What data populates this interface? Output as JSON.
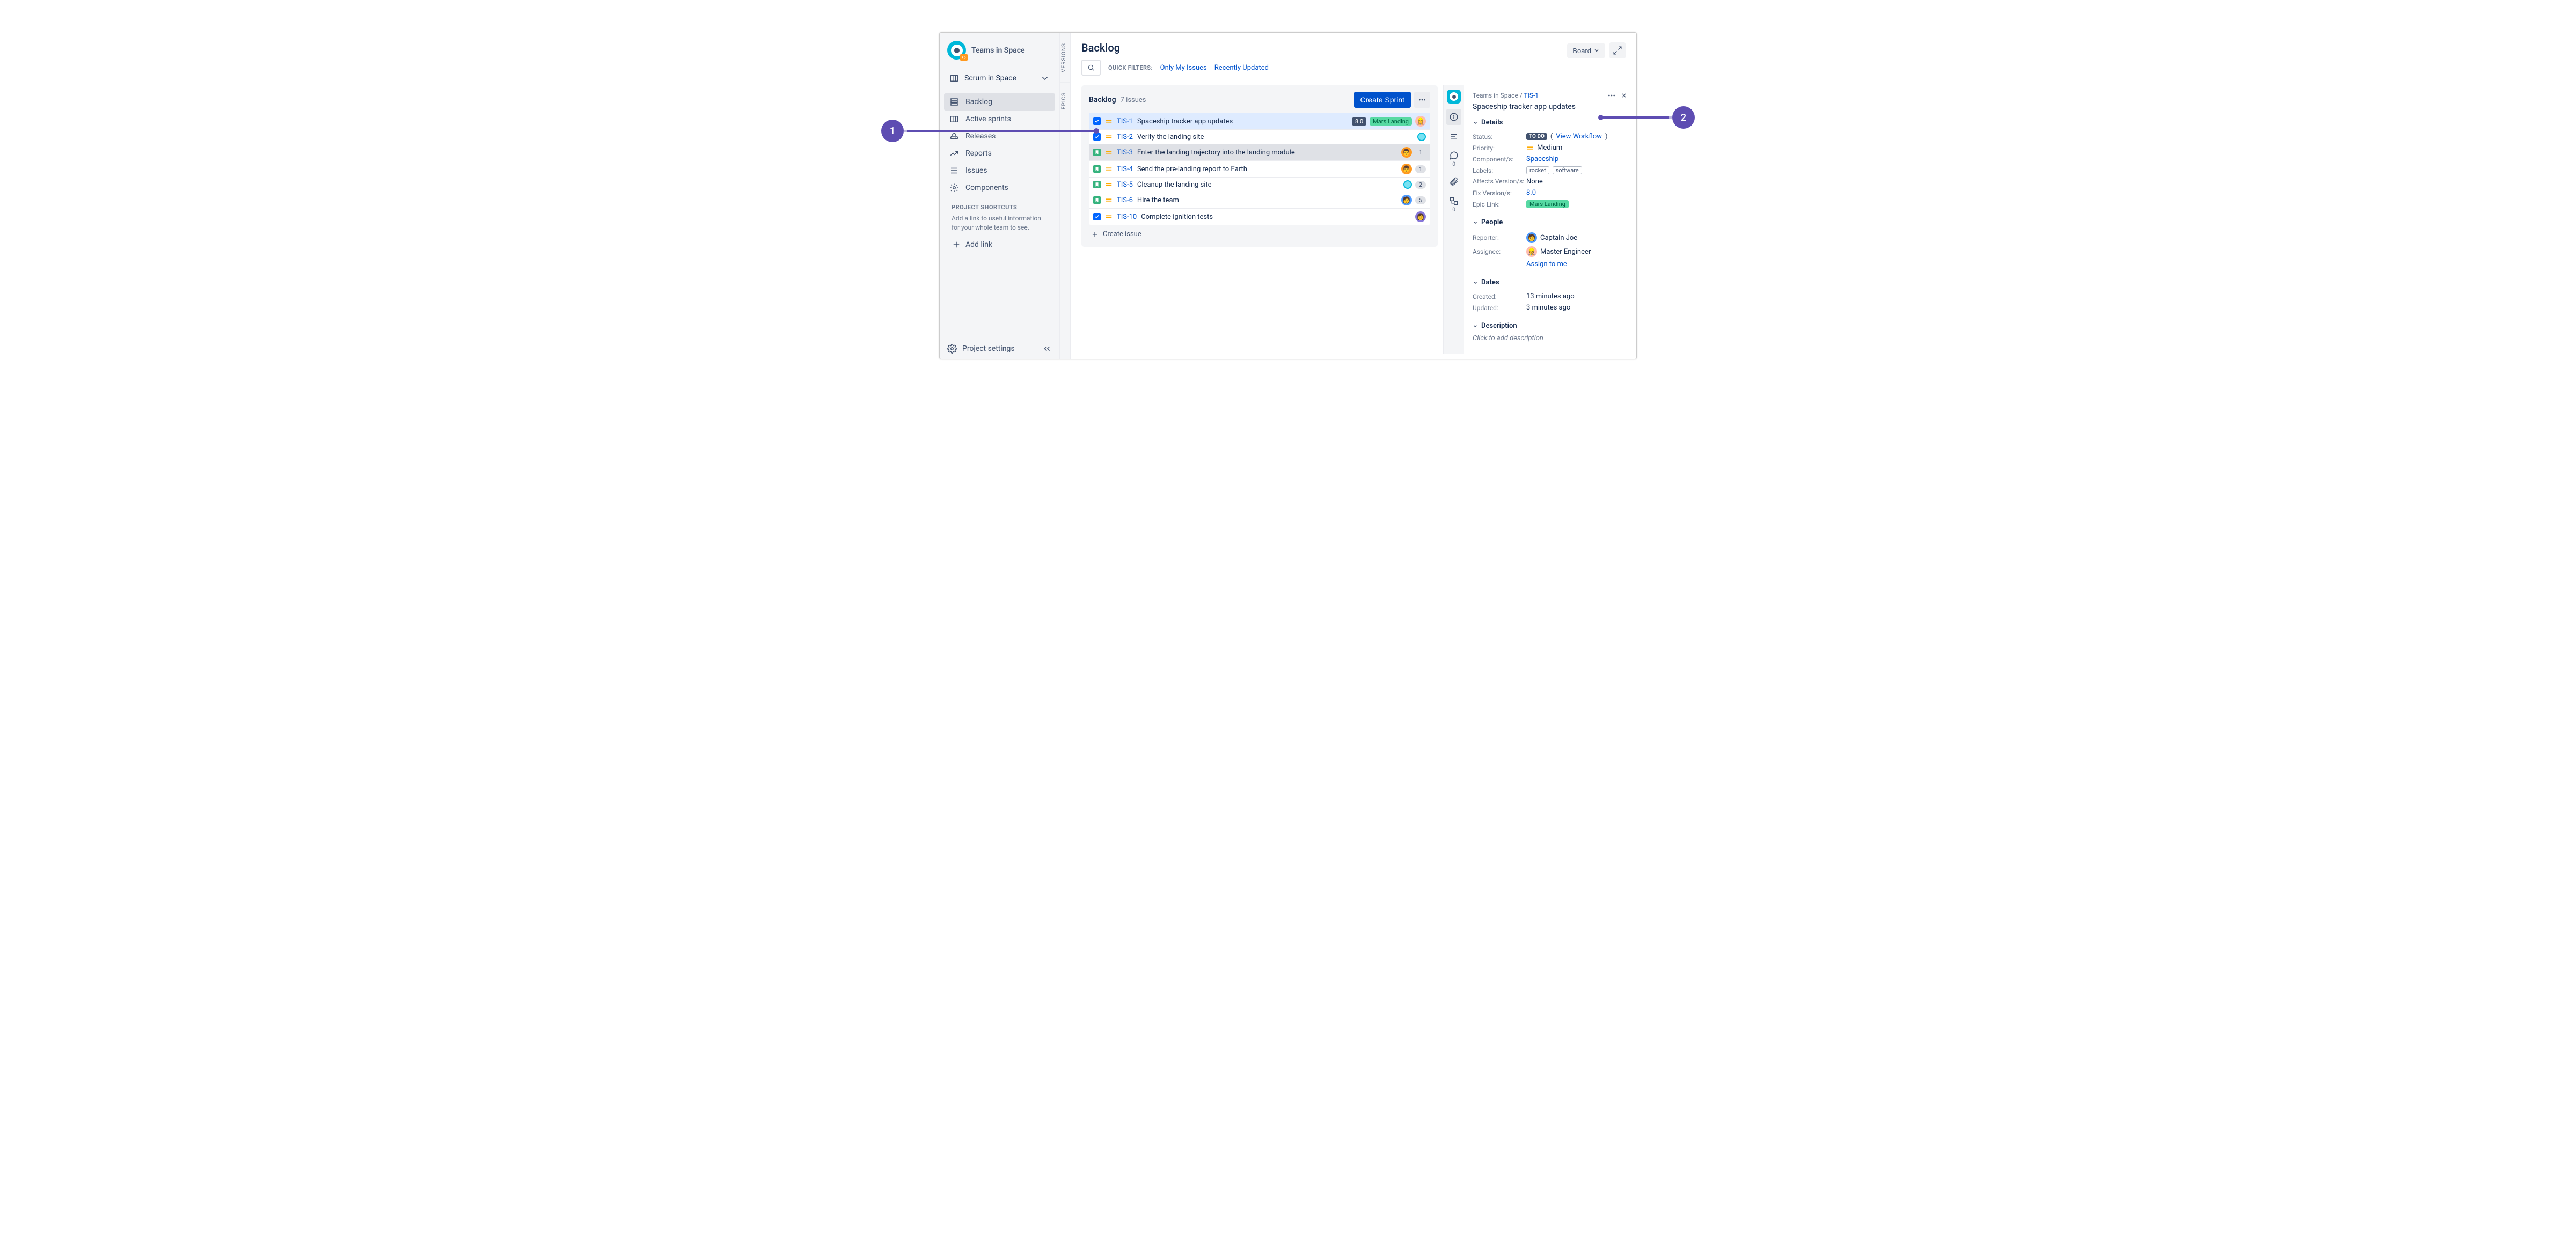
{
  "sidebar": {
    "project_name": "Teams in Space",
    "board_selector": "Scrum in Space",
    "nav": [
      {
        "label": "Backlog",
        "icon": "backlog",
        "active": true
      },
      {
        "label": "Active sprints",
        "icon": "board",
        "active": false
      },
      {
        "label": "Releases",
        "icon": "ship",
        "active": false
      },
      {
        "label": "Reports",
        "icon": "graph",
        "active": false
      },
      {
        "label": "Issues",
        "icon": "list",
        "active": false
      },
      {
        "label": "Components",
        "icon": "component",
        "active": false
      }
    ],
    "shortcuts_title": "PROJECT SHORTCUTS",
    "shortcuts_desc": "Add a link to useful information for your whole team to see.",
    "add_link": "Add link",
    "settings": "Project settings"
  },
  "vtabs": [
    "VERSIONS",
    "EPICS"
  ],
  "header": {
    "title": "Backlog",
    "quick_filters_label": "QUICK FILTERS:",
    "filters": [
      "Only My Issues",
      "Recently Updated"
    ],
    "board_btn": "Board"
  },
  "backlog": {
    "title": "Backlog",
    "count": "7 issues",
    "create_sprint": "Create Sprint",
    "create_issue": "Create issue",
    "issues": [
      {
        "type": "task",
        "key": "TIS-1",
        "summary": "Spaceship tracker app updates",
        "version": "8.0",
        "epic": "Mars Landing",
        "avatar": "red",
        "selected": true,
        "count": null
      },
      {
        "type": "task",
        "key": "TIS-2",
        "summary": "Verify the landing site",
        "avatar": "teal",
        "count": null
      },
      {
        "type": "story",
        "key": "TIS-3",
        "summary": "Enter the landing trajectory into the landing module",
        "avatar": "orange",
        "flagged": true,
        "count": "1"
      },
      {
        "type": "story",
        "key": "TIS-4",
        "summary": "Send the pre-landing report to Earth",
        "avatar": "orange",
        "count": "1"
      },
      {
        "type": "story",
        "key": "TIS-5",
        "summary": "Cleanup the landing site",
        "avatar": "teal",
        "count": "2"
      },
      {
        "type": "story",
        "key": "TIS-6",
        "summary": "Hire the team",
        "avatar": "blue",
        "count": "5"
      },
      {
        "type": "task",
        "key": "TIS-10",
        "summary": "Complete ignition tests",
        "avatar": "purple",
        "count": null
      }
    ]
  },
  "detail": {
    "breadcrumb_project": "Teams in Space",
    "breadcrumb_sep": " / ",
    "breadcrumb_key": "TIS-1",
    "title": "Spaceship tracker app updates",
    "sections": {
      "details": {
        "heading": "Details",
        "status_label": "Status:",
        "status": "TO DO",
        "view_workflow": "View Workflow",
        "priority_label": "Priority:",
        "priority": "Medium",
        "component_label": "Component/s:",
        "component": "Spaceship",
        "labels_label": "Labels:",
        "labels": [
          "rocket",
          "software"
        ],
        "affects_label": "Affects Version/s:",
        "affects": "None",
        "fix_label": "Fix Version/s:",
        "fix": "8.0",
        "epic_label": "Epic Link:",
        "epic": "Mars Landing"
      },
      "people": {
        "heading": "People",
        "reporter_label": "Reporter:",
        "reporter": "Captain Joe",
        "assignee_label": "Assignee:",
        "assignee": "Master Engineer",
        "assign_to_me": "Assign to me"
      },
      "dates": {
        "heading": "Dates",
        "created_label": "Created:",
        "created": "13 minutes ago",
        "updated_label": "Updated:",
        "updated": "3 minutes ago"
      },
      "description": {
        "heading": "Description",
        "placeholder": "Click to add description"
      }
    },
    "icon_strip_counts": {
      "comments": "0",
      "subtasks": "0"
    }
  },
  "callouts": {
    "1": "1",
    "2": "2"
  }
}
